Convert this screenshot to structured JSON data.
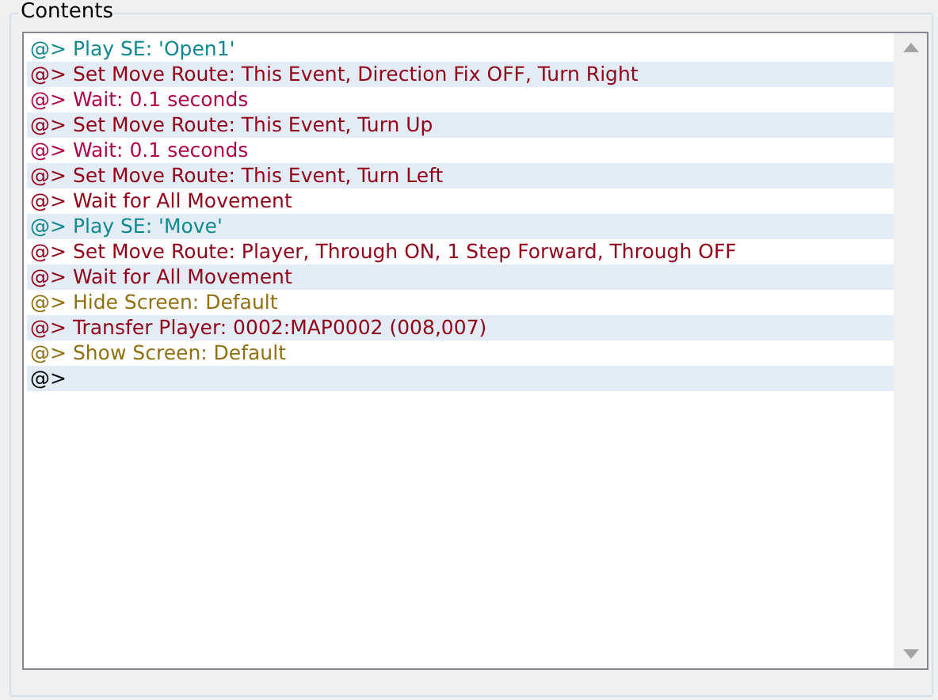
{
  "group_title": "Contents",
  "lines": [
    {
      "text": "@> Play SE: 'Open1'",
      "color": "#108890"
    },
    {
      "text": "@> Set Move Route: This Event, Direction Fix OFF, Turn Right",
      "color": "#900018"
    },
    {
      "text": "@> Wait: 0.1 seconds",
      "color": "#b00048"
    },
    {
      "text": "@> Set Move Route: This Event, Turn Up",
      "color": "#900018"
    },
    {
      "text": "@> Wait: 0.1 seconds",
      "color": "#b00048"
    },
    {
      "text": "@> Set Move Route: This Event, Turn Left",
      "color": "#900018"
    },
    {
      "text": "@> Wait for All Movement",
      "color": "#900018"
    },
    {
      "text": "@> Play SE: 'Move'",
      "color": "#108890"
    },
    {
      "text": "@> Set Move Route: Player, Through ON, 1 Step Forward, Through OFF",
      "color": "#900018"
    },
    {
      "text": "@> Wait for All Movement",
      "color": "#900018"
    },
    {
      "text": "@> Hide Screen: Default",
      "color": "#907010"
    },
    {
      "text": "@> Transfer Player: 0002:MAP0002 (008,007)",
      "color": "#900018"
    },
    {
      "text": "@> Show Screen: Default",
      "color": "#907010"
    },
    {
      "text": "@>",
      "color": "#000000"
    }
  ]
}
